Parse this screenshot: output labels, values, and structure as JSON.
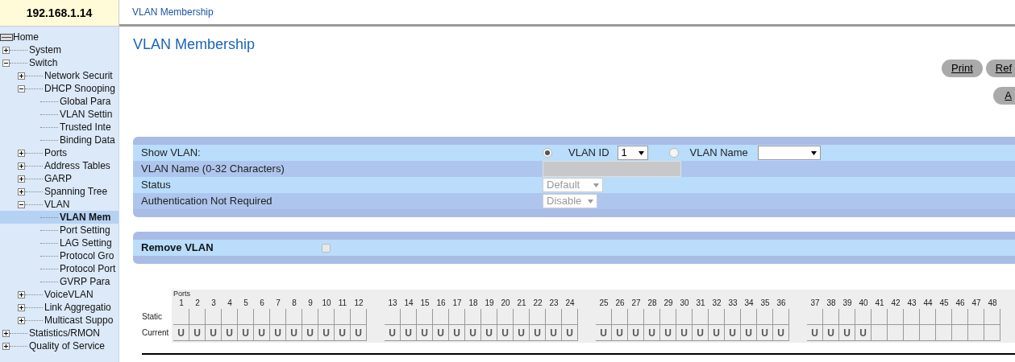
{
  "device": {
    "address": "192.168.1.14"
  },
  "header": {
    "title": "VLAN Membership"
  },
  "sidebar": {
    "items": [
      {
        "label": "Home",
        "selected": false,
        "children": [
          {
            "label": "System",
            "expanded": false,
            "selected": false
          },
          {
            "label": "Switch",
            "expanded": true,
            "selected": false,
            "children": [
              {
                "label": "Network Securit",
                "expanded": false,
                "selected": false
              },
              {
                "label": "DHCP Snooping",
                "expanded": true,
                "selected": false,
                "children": [
                  {
                    "label": "Global Para",
                    "selected": false
                  },
                  {
                    "label": "VLAN Settin",
                    "selected": false
                  },
                  {
                    "label": "Trusted Inte",
                    "selected": false
                  },
                  {
                    "label": "Binding Data",
                    "selected": false
                  }
                ]
              },
              {
                "label": "Ports",
                "expanded": false,
                "selected": false
              },
              {
                "label": "Address Tables",
                "expanded": false,
                "selected": false
              },
              {
                "label": "GARP",
                "expanded": false,
                "selected": false
              },
              {
                "label": "Spanning Tree",
                "expanded": false,
                "selected": false
              },
              {
                "label": "VLAN",
                "expanded": true,
                "selected": false,
                "children": [
                  {
                    "label": "VLAN Mem",
                    "selected": true
                  },
                  {
                    "label": "Port Setting",
                    "selected": false
                  },
                  {
                    "label": "LAG Setting",
                    "selected": false
                  },
                  {
                    "label": "Protocol Gro",
                    "selected": false
                  },
                  {
                    "label": "Protocol Port",
                    "selected": false
                  },
                  {
                    "label": "GVRP Para",
                    "selected": false
                  }
                ]
              },
              {
                "label": "VoiceVLAN",
                "expanded": false,
                "selected": false
              },
              {
                "label": "Link Aggregatio",
                "expanded": false,
                "selected": false
              },
              {
                "label": "Multicast Suppo",
                "expanded": false,
                "selected": false
              }
            ]
          },
          {
            "label": "Statistics/RMON",
            "expanded": false,
            "selected": false
          },
          {
            "label": "Quality of Service",
            "expanded": false,
            "selected": false
          }
        ]
      }
    ]
  },
  "page": {
    "title": "VLAN Membership",
    "buttons": [
      "Print",
      "Ref"
    ],
    "second_row_buttons": [
      "A"
    ]
  },
  "vlan_form": {
    "show_vlan": {
      "label": "Show VLAN:",
      "options": [
        {
          "label": "VLAN ID",
          "selected": true,
          "value": "1"
        },
        {
          "label": "VLAN Name",
          "selected": false
        }
      ]
    },
    "vlan_name": {
      "label": "VLAN Name (0-32 Characters)",
      "disabled": true
    },
    "status": {
      "label": "Status",
      "value": "Default",
      "disabled": true
    },
    "authentication": {
      "label": "Authentication Not Required",
      "value": "Disable",
      "disabled": true
    }
  },
  "remove_vlan": {
    "label": "Remove VLAN",
    "checked": false,
    "disabled": true
  },
  "ports_table": {
    "heading": "Ports",
    "row_labels": [
      "Static",
      "Current"
    ],
    "groups": [
      {
        "ports": [
          {
            "port": "1",
            "current": "U"
          },
          {
            "port": "2",
            "current": "U"
          },
          {
            "port": "3",
            "current": "U"
          },
          {
            "port": "4",
            "current": "U"
          },
          {
            "port": "5",
            "current": "U"
          },
          {
            "port": "6",
            "current": "U"
          },
          {
            "port": "7",
            "current": "U"
          },
          {
            "port": "8",
            "current": "U"
          },
          {
            "port": "9",
            "current": "U"
          },
          {
            "port": "10",
            "current": "U"
          },
          {
            "port": "11",
            "current": "U"
          },
          {
            "port": "12",
            "current": "U"
          }
        ]
      },
      {
        "ports": [
          {
            "port": "13",
            "current": "U"
          },
          {
            "port": "14",
            "current": "U"
          },
          {
            "port": "15",
            "current": "U"
          },
          {
            "port": "16",
            "current": "U"
          },
          {
            "port": "17",
            "current": "U"
          },
          {
            "port": "18",
            "current": "U"
          },
          {
            "port": "19",
            "current": "U"
          },
          {
            "port": "20",
            "current": "U"
          },
          {
            "port": "21",
            "current": "U"
          },
          {
            "port": "22",
            "current": "U"
          },
          {
            "port": "23",
            "current": "U"
          },
          {
            "port": "24",
            "current": "U"
          }
        ]
      },
      {
        "ports": [
          {
            "port": "25",
            "current": "U"
          },
          {
            "port": "26",
            "current": "U"
          },
          {
            "port": "27",
            "current": "U"
          },
          {
            "port": "28",
            "current": "U"
          },
          {
            "port": "29",
            "current": "U"
          },
          {
            "port": "30",
            "current": "U"
          },
          {
            "port": "31",
            "current": "U"
          },
          {
            "port": "32",
            "current": "U"
          },
          {
            "port": "33",
            "current": "U"
          },
          {
            "port": "34",
            "current": "U"
          },
          {
            "port": "35",
            "current": "U"
          },
          {
            "port": "36",
            "current": "U"
          }
        ]
      },
      {
        "ports": [
          {
            "port": "37",
            "current": "U"
          },
          {
            "port": "38",
            "current": "U"
          },
          {
            "port": "39",
            "current": "U"
          },
          {
            "port": "40",
            "current": "U"
          },
          {
            "port": "41"
          },
          {
            "port": "42"
          },
          {
            "port": "43"
          },
          {
            "port": "44"
          },
          {
            "port": "45"
          },
          {
            "port": "46"
          },
          {
            "port": "47"
          },
          {
            "port": "48"
          }
        ]
      }
    ]
  }
}
